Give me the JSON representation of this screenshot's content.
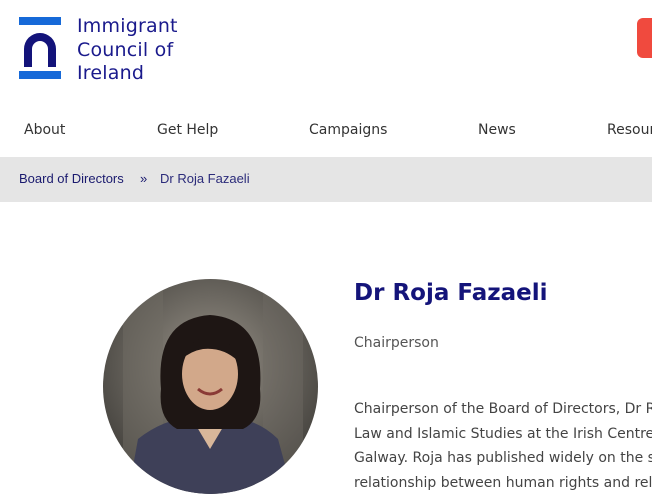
{
  "header": {
    "logo_text": "Immigrant\nCouncil of\nIreland",
    "brand_color": "#1a1a8c",
    "button_color": "#f04a3e"
  },
  "nav": {
    "items": [
      "About",
      "Get Help",
      "Campaigns",
      "News",
      "Resources"
    ]
  },
  "breadcrumb": {
    "parent": "Board of Directors",
    "separator": "»",
    "current": "Dr Roja Fazaeli"
  },
  "profile": {
    "name": "Dr Roja Fazaeli",
    "role": "Chairperson",
    "bio_lines": [
      "Chairperson of the Board of Directors, Dr Ro",
      "Law and Islamic Studies at the Irish Centre f",
      "Galway. Roja has published widely on the su",
      "relationship between human rights and reli"
    ]
  }
}
